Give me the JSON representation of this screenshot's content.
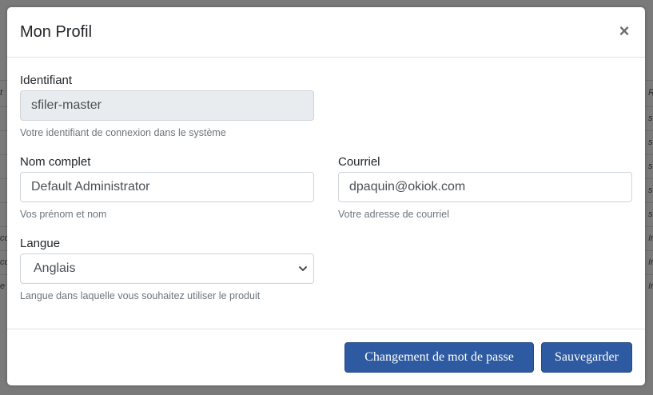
{
  "background": {
    "left_fragments": [
      "t",
      "",
      "",
      "",
      "",
      "",
      "co",
      "co",
      "e"
    ],
    "right_fragments": [
      "R",
      "s",
      "s",
      "s",
      "s",
      "s",
      "Ir",
      "Ir",
      "Ir"
    ]
  },
  "modal": {
    "title": "Mon Profil",
    "close_symbol": "×"
  },
  "form": {
    "username": {
      "label": "Identifiant",
      "value": "sfiler-master",
      "help": "Votre identifiant de connexion dans le système"
    },
    "fullname": {
      "label": "Nom complet",
      "value": "Default Administrator",
      "help": "Vos prénom et nom"
    },
    "email": {
      "label": "Courriel",
      "value": "dpaquin@okiok.com",
      "help": "Votre adresse de courriel"
    },
    "language": {
      "label": "Langue",
      "selected": "Anglais",
      "help": "Langue dans laquelle vous souhaitez utiliser le produit"
    }
  },
  "footer": {
    "change_password_label": "Changement de mot de passe",
    "save_label": "Sauvegarder"
  },
  "colors": {
    "primary_button": "#2d5aa0",
    "backdrop": "#7a7a7a"
  }
}
